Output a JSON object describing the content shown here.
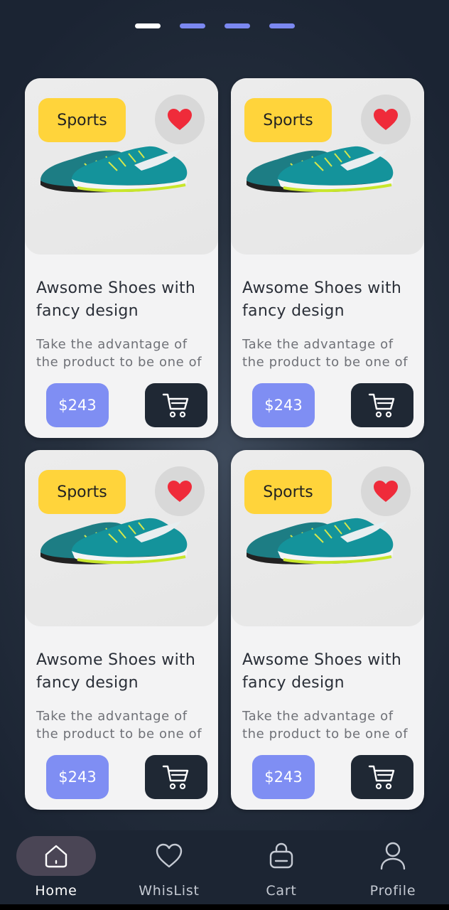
{
  "carousel": {
    "pages": 4,
    "active_index": 0
  },
  "colors": {
    "indicator_active": "#ffffff",
    "indicator_inactive": "#7b88f0",
    "badge": "#ffd43b",
    "price": "#7f8ef3",
    "cart_button": "#1f2834",
    "heart": "#ef2b3a"
  },
  "products": [
    {
      "category": "Sports",
      "title_line1": "Awsome Shoes with",
      "title_line2": "fancy design",
      "desc_line1": "Take the advantage of",
      "desc_line2": "the product to be one of",
      "price": "$243",
      "favorited": true,
      "image_icon": "running-shoe-image",
      "cart_icon": "cart-icon"
    },
    {
      "category": "Sports",
      "title_line1": "Awsome Shoes with",
      "title_line2": "fancy design",
      "desc_line1": "Take the advantage of",
      "desc_line2": "the product to be one of",
      "price": "$243",
      "favorited": true,
      "image_icon": "running-shoe-image",
      "cart_icon": "cart-icon"
    },
    {
      "category": "Sports",
      "title_line1": "Awsome Shoes with",
      "title_line2": "fancy design",
      "desc_line1": "Take the advantage of",
      "desc_line2": "the product to be one of",
      "price": "$243",
      "favorited": true,
      "image_icon": "running-shoe-image",
      "cart_icon": "cart-icon"
    },
    {
      "category": "Sports",
      "title_line1": "Awsome Shoes with",
      "title_line2": "fancy design",
      "desc_line1": "Take the advantage of",
      "desc_line2": "the product to be one of",
      "price": "$243",
      "favorited": true,
      "image_icon": "running-shoe-image",
      "cart_icon": "cart-icon"
    }
  ],
  "nav": {
    "items": [
      {
        "label": "Home",
        "icon": "home-icon",
        "active": true
      },
      {
        "label": "WhisList",
        "icon": "heart-outline-icon",
        "active": false
      },
      {
        "label": "Cart",
        "icon": "shopping-bag-icon",
        "active": false
      },
      {
        "label": "Profile",
        "icon": "user-icon",
        "active": false
      }
    ]
  }
}
